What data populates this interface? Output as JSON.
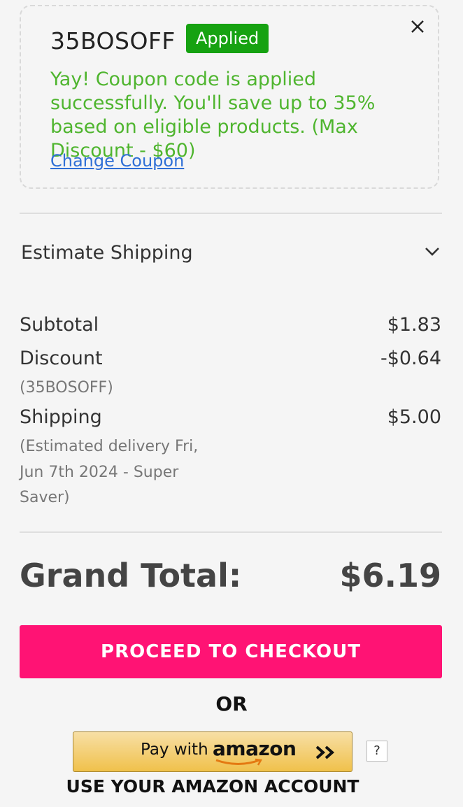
{
  "coupon": {
    "code": "35BOSOFF",
    "status_badge": "Applied",
    "message": "Yay! Coupon code is applied successfully. You'll save up to 35% based on eligible products. (Max Discount - $60)",
    "change_link": "Change Coupon",
    "close_icon": "close-icon"
  },
  "shipping_estimate": {
    "label": "Estimate Shipping",
    "expand_icon": "chevron-down-icon"
  },
  "summary": {
    "subtotal_label": "Subtotal",
    "subtotal_value": "$1.83",
    "discount_label": "Discount",
    "discount_value": "-$0.64",
    "discount_note": "(35BOSOFF)",
    "shipping_label": "Shipping",
    "shipping_value": "$5.00",
    "shipping_note_line1": "(Estimated delivery Fri,",
    "shipping_note_line2": "Jun 7th 2024 - Super",
    "shipping_note_line3": "Saver)"
  },
  "grand_total": {
    "label": "Grand Total:",
    "value": "$6.19"
  },
  "checkout": {
    "button_label": "PROCEED TO CHECKOUT",
    "or_text": "OR"
  },
  "amazon_pay": {
    "pay_with": "Pay with",
    "brand": "amazon",
    "help": "?",
    "caption": "USE YOUR AMAZON ACCOUNT"
  },
  "colors": {
    "success_green": "#4fb52f",
    "badge_green": "#16a211",
    "link_blue": "#2f6fd6",
    "checkout_pink": "#ff1374",
    "amazon_gold": "#f0c14b"
  }
}
